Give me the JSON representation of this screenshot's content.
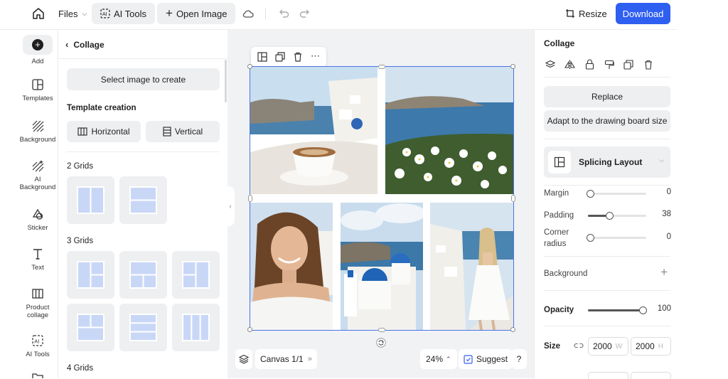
{
  "topbar": {
    "files_label": "Files",
    "ai_tools_label": "AI Tools",
    "open_image_label": "Open Image",
    "resize_label": "Resize",
    "download_label": "Download",
    "accent_color": "#2f5ff0"
  },
  "left_rail": {
    "items": [
      {
        "label": "Add",
        "icon": "plus-circle-icon"
      },
      {
        "label": "Templates",
        "icon": "templates-icon"
      },
      {
        "label": "Background",
        "icon": "background-icon"
      },
      {
        "label": "AI\nBackground",
        "icon": "ai-background-icon"
      },
      {
        "label": "Sticker",
        "icon": "sticker-icon"
      },
      {
        "label": "Text",
        "icon": "text-icon"
      },
      {
        "label": "Product\ncollage",
        "icon": "product-collage-icon"
      },
      {
        "label": "AI Tools",
        "icon": "ai-tools-icon"
      }
    ]
  },
  "panel": {
    "title": "Collage",
    "select_image_label": "Select image to create",
    "template_creation_title": "Template creation",
    "horizontal_label": "Horizontal",
    "vertical_label": "Vertical",
    "grids_2_title": "2 Grids",
    "grids_3_title": "3 Grids",
    "grids_4_title": "4 Grids"
  },
  "canvas": {
    "page_label": "Canvas 1/1",
    "zoom_label": "24%",
    "suggest_label": "Suggest",
    "help_label": "?"
  },
  "right_panel": {
    "title": "Collage",
    "replace_label": "Replace",
    "adapt_label": "Adapt to the drawing board size",
    "layout_label": "Splicing Layout",
    "margin_label": "Margin",
    "margin_value": "0",
    "padding_label": "Padding",
    "padding_value": "38",
    "corner_label": "Corner\nradius",
    "corner_value": "0",
    "background_label": "Background",
    "opacity_label": "Opacity",
    "opacity_value": "100",
    "size_label": "Size",
    "width_value": "2000",
    "width_unit": "W",
    "height_value": "2000",
    "height_unit": "H"
  }
}
